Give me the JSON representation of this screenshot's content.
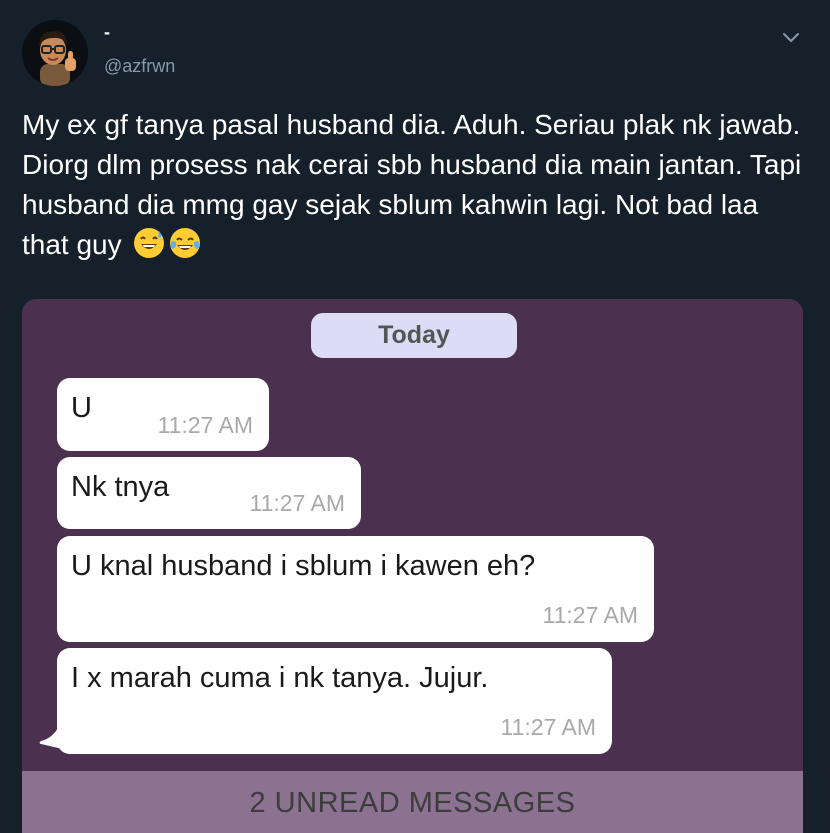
{
  "user": {
    "display_name": "-",
    "handle": "@azfrwn",
    "avatar_icon": "memoji-thumbs-up-avatar"
  },
  "header": {
    "more_icon": "chevron-down-icon"
  },
  "tweet": {
    "text": "My ex gf tanya pasal husband dia. Aduh. Seriau plak nk jawab. Diorg dlm prosess nak cerai sbb husband dia main jantan. Tapi husband dia mmg gay sejak sblum kahwin lagi. Not bad laa that guy",
    "emojis": [
      "sweat-smile-emoji",
      "tears-of-joy-emoji"
    ]
  },
  "chat": {
    "date_label": "Today",
    "messages": [
      {
        "text": "U",
        "time": "11:27 AM"
      },
      {
        "text": "Nk tnya",
        "time": "11:27 AM"
      },
      {
        "text": "U knal husband i sblum i kawen eh?",
        "time": "11:27 AM"
      },
      {
        "text": "I x marah cuma i nk tanya. Jujur.",
        "time": "11:27 AM"
      }
    ],
    "unread_label": "2 UNREAD MESSAGES"
  },
  "colors": {
    "background": "#15202b",
    "chat_background": "#4b3050",
    "date_pill": "#dcdcf6",
    "unread_bar": "#8a7290",
    "handle_text": "#8899a6"
  }
}
